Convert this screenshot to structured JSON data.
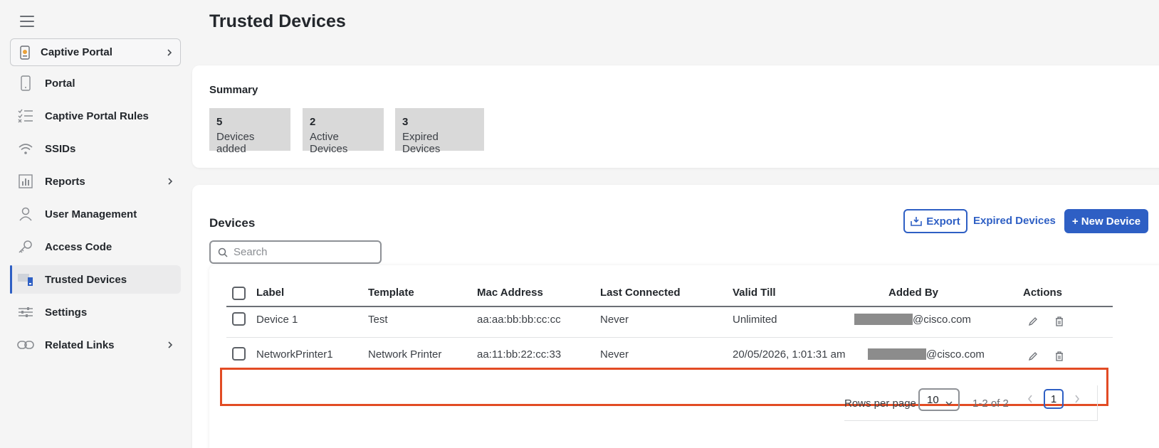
{
  "sidebar": {
    "portal_select": {
      "label": "Captive Portal"
    },
    "items": [
      {
        "label": "Portal",
        "icon": "phone-icon",
        "has_children": false,
        "active": false
      },
      {
        "label": "Captive Portal Rules",
        "icon": "rules-checklist-icon",
        "has_children": false,
        "active": false
      },
      {
        "label": "SSIDs",
        "icon": "wifi-icon",
        "has_children": false,
        "active": false
      },
      {
        "label": "Reports",
        "icon": "bar-chart-icon",
        "has_children": true,
        "active": false
      },
      {
        "label": "User Management",
        "icon": "user-icon",
        "has_children": false,
        "active": false
      },
      {
        "label": "Access Code",
        "icon": "key-icon",
        "has_children": false,
        "active": false
      },
      {
        "label": "Trusted Devices",
        "icon": "devices-icon",
        "has_children": false,
        "active": true
      },
      {
        "label": "Settings",
        "icon": "sliders-icon",
        "has_children": false,
        "active": false
      },
      {
        "label": "Related Links",
        "icon": "link-icon",
        "has_children": true,
        "active": false
      }
    ]
  },
  "page": {
    "title": "Trusted Devices"
  },
  "summary": {
    "title": "Summary",
    "stats": [
      {
        "value": "5",
        "label": "Devices added"
      },
      {
        "value": "2",
        "label": "Active Devices"
      },
      {
        "value": "3",
        "label": "Expired Devices"
      }
    ]
  },
  "devices": {
    "title": "Devices",
    "export_label": "Export",
    "expired_link": "Expired Devices",
    "new_device_label": "+ New Device",
    "search_placeholder": "Search",
    "columns": [
      "Label",
      "Template",
      "Mac Address",
      "Last Connected",
      "Valid Till",
      "Added By",
      "Actions"
    ],
    "rows": [
      {
        "label": "Device 1",
        "template": "Test",
        "mac": "aa:aa:bb:bb:cc:cc",
        "last_connected": "Never",
        "valid_till": "Unlimited",
        "added_by_suffix": "@cisco.com"
      },
      {
        "label": "NetworkPrinter1",
        "template": "Network Printer",
        "mac": "aa:11:bb:22:cc:33",
        "last_connected": "Never",
        "valid_till": "20/05/2026, 1:01:31 am",
        "added_by_suffix": "@cisco.com"
      }
    ],
    "highlighted_row": 1
  },
  "pagination": {
    "rows_per_page_label": "Rows per page",
    "rows_per_page": "10",
    "range": "1-2 of 2",
    "current_page": "1"
  },
  "colors": {
    "accent": "#2e5fc4",
    "highlight": "#e24b24",
    "stat_bg": "#d9d9d9"
  }
}
